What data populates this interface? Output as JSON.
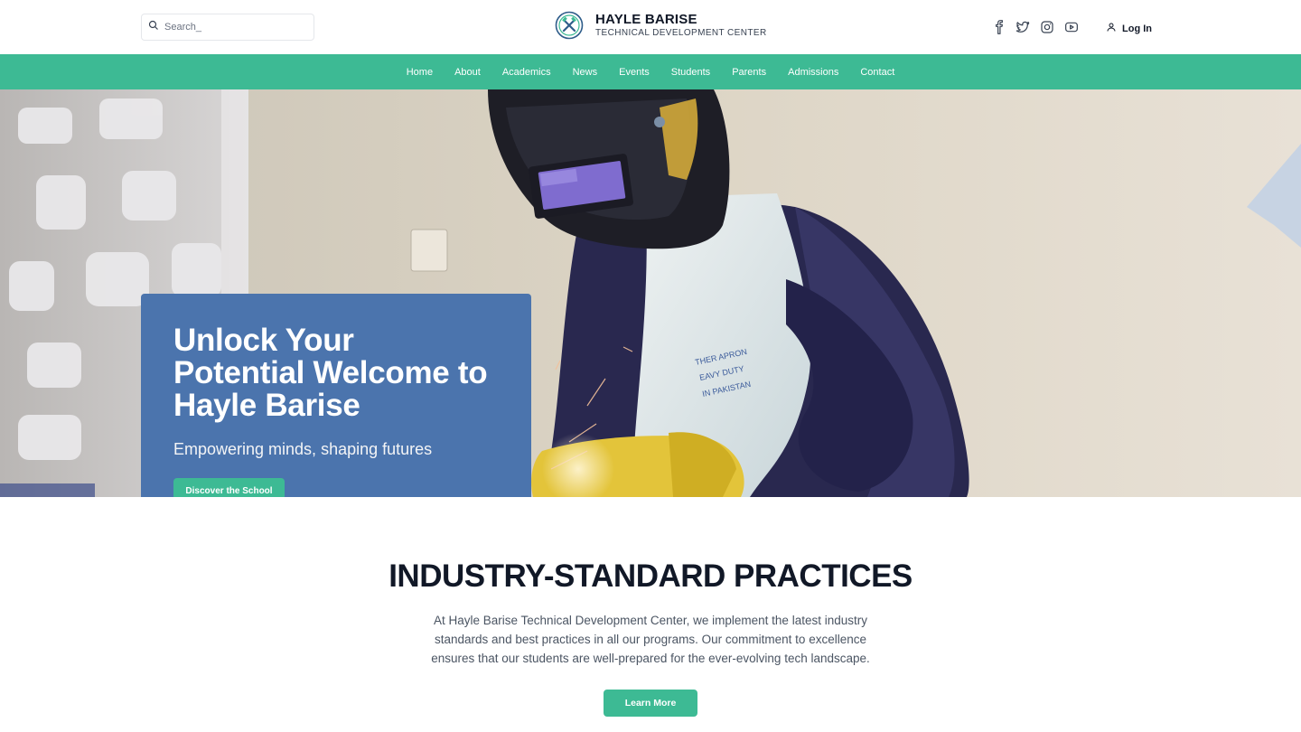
{
  "header": {
    "search_placeholder": "Search_",
    "brand_name": "HAYLE BARISE",
    "brand_subtitle": "TECHNICAL DEVELOPMENT CENTER",
    "social_icons": [
      "facebook-icon",
      "twitter-icon",
      "instagram-icon",
      "youtube-icon"
    ],
    "login_label": "Log In"
  },
  "nav": {
    "items": [
      {
        "label": "Home"
      },
      {
        "label": "About"
      },
      {
        "label": "Academics"
      },
      {
        "label": "News"
      },
      {
        "label": "Events"
      },
      {
        "label": "Students"
      },
      {
        "label": "Parents"
      },
      {
        "label": "Admissions"
      },
      {
        "label": "Contact"
      }
    ]
  },
  "hero": {
    "title": "Unlock Your Potential Welcome to Hayle Barise",
    "subtitle": "Empowering minds, shaping futures",
    "button_label": "Discover the School"
  },
  "section": {
    "title": "INDUSTRY-STANDARD PRACTICES",
    "body": "At Hayle Barise Technical Development Center, we implement the latest industry standards and best practices in all our programs. Our commitment to excellence ensures that our students are well-prepared for the ever-evolving tech landscape.",
    "button_label": "Learn More"
  },
  "colors": {
    "accent": "#3dba94",
    "hero_card": "#4b74ad",
    "text_dark": "#111827"
  }
}
